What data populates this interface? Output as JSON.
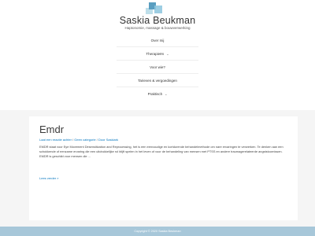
{
  "site": {
    "title": "Saskia Beukman",
    "tagline": "Haptonomie, massage & bouwverwerking"
  },
  "nav": {
    "items": [
      {
        "label": "Over mij",
        "dropdown": false
      },
      {
        "label": "Therapieën",
        "dropdown": true
      },
      {
        "label": "Voor wie?",
        "dropdown": false
      },
      {
        "label": "Tarieven & vergoedingen",
        "dropdown": false
      },
      {
        "label": "Praktisch",
        "dropdown": true
      }
    ],
    "chevron": "⌄"
  },
  "post": {
    "title": "Emdr",
    "meta": {
      "comment_link": "Laat een reactie achter",
      "separator": " / ",
      "category": "Geen categorie",
      "author": "Door Saskiark"
    },
    "excerpt": "EMDR staat voor Eye Movement Desensitization and Reprocessing, het is een eenvoudige en kortdurende behandelmethode om nare ervaringen te verwerken. Te denken aan een schokkende of eenzame ervaring die een uitdrukkelijke rol blijft spelen in het leven of voor de behandeling van mensen met PTSS en andere traumagerelateerde angststoornissen. EMDR is geschikt voor mensen die ...",
    "read_more": "Lees verder »"
  },
  "footer": {
    "copyright": "Copyright © 2020 Saskia Beukman"
  },
  "colors": {
    "link": "#0274be",
    "footer_bg": "#a7c7d9",
    "page_bg": "#f5f5f5"
  }
}
